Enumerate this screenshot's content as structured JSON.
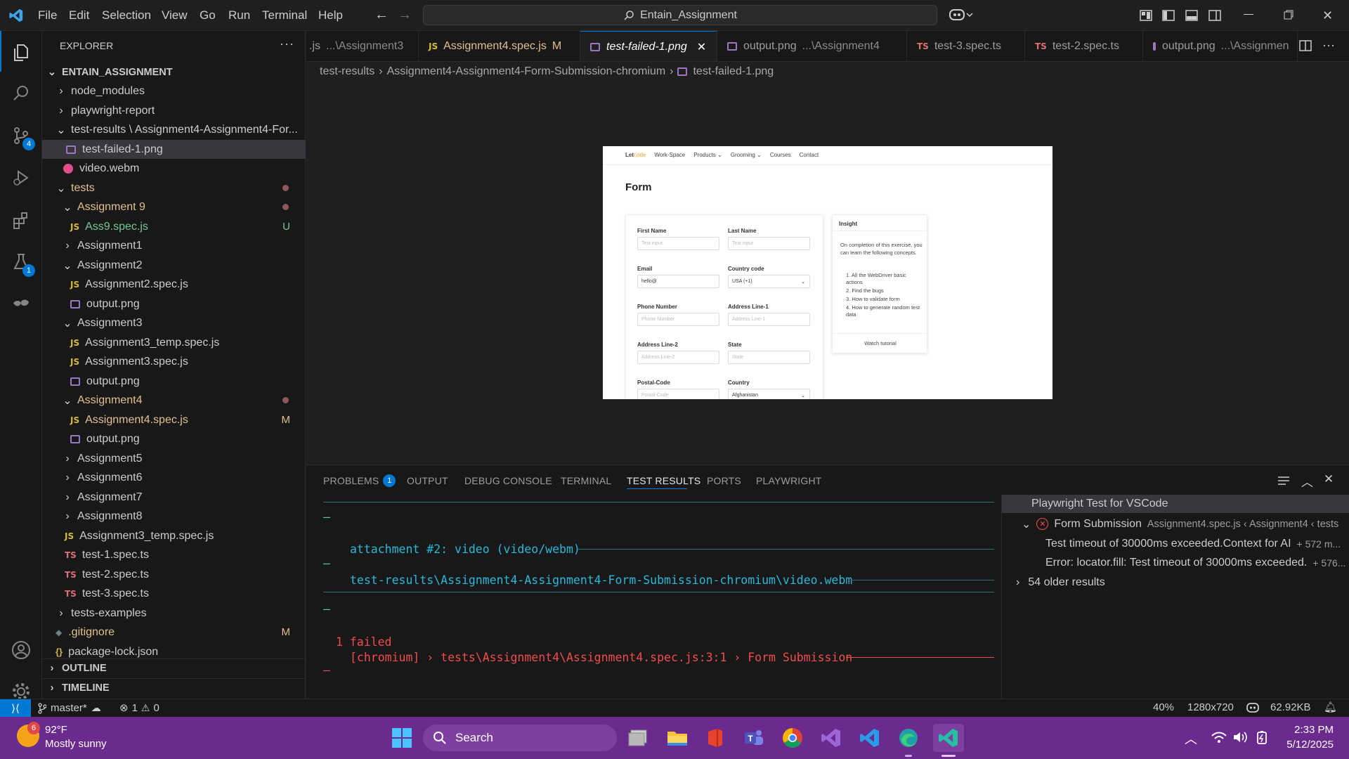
{
  "menu": [
    "File",
    "Edit",
    "Selection",
    "View",
    "Go",
    "Run",
    "Terminal",
    "Help"
  ],
  "command_center": "Entain_Assignment",
  "activity": {
    "source_control_badge": "4",
    "testing_badge": "1"
  },
  "explorer": {
    "title": "EXPLORER",
    "root": "ENTAIN_ASSIGNMENT",
    "items": [
      {
        "label": "node_modules"
      },
      {
        "label": "playwright-report"
      },
      {
        "label": "test-results \\ Assignment4-Assignment4-For..."
      },
      {
        "label": "test-failed-1.png"
      },
      {
        "label": "video.webm"
      },
      {
        "label": "tests"
      },
      {
        "label": "Assignment 9"
      },
      {
        "label": "Ass9.spec.js",
        "deco": "U"
      },
      {
        "label": "Assignment1"
      },
      {
        "label": "Assignment2"
      },
      {
        "label": "Assignment2.spec.js"
      },
      {
        "label": "output.png"
      },
      {
        "label": "Assignment3"
      },
      {
        "label": "Assignment3_temp.spec.js"
      },
      {
        "label": "Assignment3.spec.js"
      },
      {
        "label": "output.png"
      },
      {
        "label": "Assignment4"
      },
      {
        "label": "Assignment4.spec.js",
        "deco": "M"
      },
      {
        "label": "output.png"
      },
      {
        "label": "Assignment5"
      },
      {
        "label": "Assignment6"
      },
      {
        "label": "Assignment7"
      },
      {
        "label": "Assignment8"
      },
      {
        "label": "Assignment3_temp.spec.js"
      },
      {
        "label": "test-1.spec.ts"
      },
      {
        "label": "test-2.spec.ts"
      },
      {
        "label": "test-3.spec.ts"
      },
      {
        "label": "tests-examples"
      },
      {
        "label": ".gitignore",
        "deco": "M"
      },
      {
        "label": "package-lock.json"
      }
    ],
    "outline": "OUTLINE",
    "timeline": "TIMELINE",
    "file_icon_letters": {
      "js": "JS",
      "ts": "TS",
      "json": "{}"
    }
  },
  "tabs": [
    {
      "label": ".js",
      "desc": "...\\Assignment3"
    },
    {
      "label": "Assignment4.spec.js",
      "desc": "M"
    },
    {
      "label": "test-failed-1.png",
      "desc": ""
    },
    {
      "label": "output.png",
      "desc": "...\\Assignment4"
    },
    {
      "label": "test-3.spec.ts",
      "desc": ""
    },
    {
      "label": "test-2.spec.ts",
      "desc": ""
    },
    {
      "label": "output.png",
      "desc": "...\\Assignmen"
    }
  ],
  "breadcrumb": [
    "test-results",
    "Assignment4-Assignment4-Form-Submission-chromium",
    "test-failed-1.png"
  ],
  "preview": {
    "logo": "Let",
    "logo_tail": "code",
    "nav": [
      "Work-Space",
      "Products",
      "Grooming",
      "Courses",
      "Contact"
    ],
    "title": "Form",
    "fields": [
      {
        "label": "First Name",
        "value": "Test input"
      },
      {
        "label": "Last Name",
        "value": "Test input"
      },
      {
        "label": "Email",
        "value": "hello@"
      },
      {
        "label": "Country code",
        "value": "USA (+1)"
      },
      {
        "label": "Phone Number",
        "value": "Phone Number"
      },
      {
        "label": "Address Line-1",
        "value": "Address Line-1"
      },
      {
        "label": "Address Line-2",
        "value": "Address Line-2"
      },
      {
        "label": "State",
        "value": "State"
      },
      {
        "label": "Postal-Code",
        "value": "Postal-Code"
      },
      {
        "label": "Country",
        "value": "Afghanistan"
      }
    ],
    "insight": {
      "title": "Insight",
      "text": "On completion of this exercise, you can learn the following concepts.",
      "list": [
        "1. All the WebDriver basic actions",
        "2. Find the bugs",
        "3. How to validate form",
        "4. How to generate random test data"
      ],
      "link": "Watch tutorial"
    }
  },
  "panel": {
    "tabs": [
      "PROBLEMS",
      "OUTPUT",
      "DEBUG CONSOLE",
      "TERMINAL",
      "TEST RESULTS",
      "PORTS",
      "PLAYWRIGHT"
    ],
    "problems_badge": "1",
    "terminal": {
      "attachment": "attachment #2: video (video/webm)",
      "path": "test-results\\Assignment4-Assignment4-Form-Submission-chromium\\video.webm",
      "failed": "1 failed",
      "failed_detail": "[chromium] › tests\\Assignment4\\Assignment4.spec.js:3:1 › Form Submission"
    },
    "results": {
      "header": "Playwright Test for VSCode",
      "test_name": "Form Submission",
      "test_loc": "Assignment4.spec.js ‹ Assignment4 ‹ tests",
      "msg1": "Test timeout of 30000ms exceeded.Context for AI",
      "msg1_meta": "+ 572 m...",
      "msg2": "Error: locator.fill: Test timeout of 30000ms exceeded.",
      "msg2_meta": "+ 576...",
      "older": "54 older results"
    }
  },
  "status": {
    "branch": "master*",
    "errors": "1",
    "warnings": "0",
    "zoom": "40%",
    "dimensions": "1280x720",
    "size": "62.92KB"
  },
  "taskbar": {
    "weather_temp": "92°F",
    "weather_desc": "Mostly sunny",
    "weather_badge": "6",
    "search": "Search",
    "time": "2:33 PM",
    "date": "5/12/2025"
  },
  "colors": {
    "accent": "#0078d4",
    "modified": "#e2c08d",
    "untracked": "#73c991",
    "error": "#f14c4c",
    "taskbar": "#6b2a8e"
  }
}
